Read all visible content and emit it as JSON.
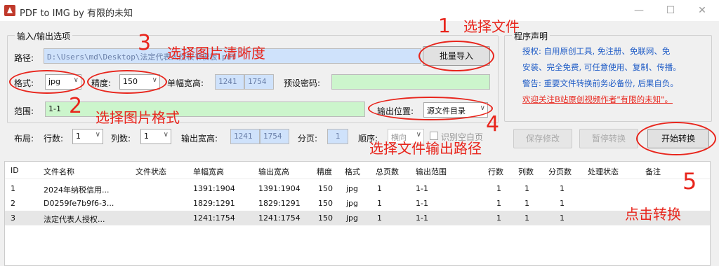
{
  "window": {
    "title": "PDF to IMG  by 有限的未知",
    "minimize": "—",
    "maximize": "☐",
    "close": "✕"
  },
  "io": {
    "group_title": "输入/输出选项",
    "path_label": "路径:",
    "path_value": "D:\\Users\\md\\Desktop\\法定代表人授权书模板.pdf",
    "batch_import": "批量导入",
    "format_label": "格式:",
    "format_value": "jpg",
    "precision_label": "精度:",
    "precision_value": "150",
    "single_size_label": "单幅宽高:",
    "single_w": "1241",
    "single_h": "1754",
    "password_label": "预设密码:",
    "password_value": "",
    "range_label": "范围:",
    "range_value": "1-1",
    "output_pos_label": "输出位置:",
    "output_pos_value": "源文件目录"
  },
  "layout": {
    "label": "布局:",
    "rows_label": "行数:",
    "rows_value": "1",
    "cols_label": "列数:",
    "cols_value": "1",
    "out_size_label": "输出宽高:",
    "out_w": "1241",
    "out_h": "1754",
    "paging_label": "分页:",
    "paging_value": "1",
    "order_label": "顺序:",
    "order_value": "横向",
    "blank_label": "识别空白页"
  },
  "buttons": {
    "save": "保存修改",
    "pause": "暂停转换",
    "start": "开始转换"
  },
  "notice": {
    "title": "程序声明",
    "line1": "授权: 自用原创工具, 免注册、免联网、免",
    "line2": "安装、完全免费, 可任意使用、复制、传播。",
    "line3": "警告: 重要文件转换前务必备份, 后果自负。",
    "line4": "欢迎关注B站原创视频作者\"有限的未知\"。"
  },
  "table": {
    "headers": [
      "ID",
      "文件名称",
      "文件状态",
      "单幅宽高",
      "输出宽高",
      "精度",
      "格式",
      "总页数",
      "输出范围",
      "行数",
      "列数",
      "分页数",
      "处理状态",
      "备注"
    ],
    "rows": [
      [
        "1",
        "2024年纳税信用...",
        "",
        "1391:1904",
        "1391:1904",
        "150",
        "jpg",
        "1",
        "1-1",
        "1",
        "1",
        "1",
        "",
        ""
      ],
      [
        "2",
        "D0259fe7b9f6-3...",
        "",
        "1829:1291",
        "1829:1291",
        "150",
        "jpg",
        "1",
        "1-1",
        "1",
        "1",
        "1",
        "",
        ""
      ],
      [
        "3",
        "法定代表人授权...",
        "",
        "1241:1754",
        "1241:1754",
        "150",
        "jpg",
        "1",
        "1-1",
        "1",
        "1",
        "1",
        "",
        ""
      ]
    ]
  },
  "annotations": {
    "n1": "1",
    "t1": "选择文件",
    "n2": "2",
    "t2": "选择图片格式",
    "n3": "3",
    "t3": "选择图片清晰度",
    "n4": "4",
    "t4": "选择文件输出路径",
    "n5": "5",
    "t5": "点击转换"
  },
  "colors": {
    "annotation": "#e8251c",
    "notice_text": "#1e5bc6",
    "path_bg": "#cfe2fb",
    "green_bg": "#ccf5cc"
  }
}
